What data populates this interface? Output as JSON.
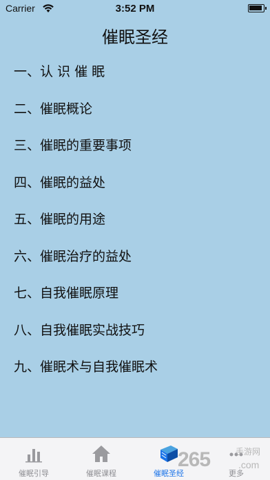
{
  "status_bar": {
    "carrier": "Carrier",
    "time": "3:52 PM"
  },
  "page": {
    "title": "催眠圣经"
  },
  "menu": {
    "items": [
      {
        "label": "一、认 识 催 眠"
      },
      {
        "label": "二、催眠概论"
      },
      {
        "label": "三、催眠的重要事项"
      },
      {
        "label": "四、催眠的益处"
      },
      {
        "label": "五、催眠的用途"
      },
      {
        "label": "六、催眠治疗的益处"
      },
      {
        "label": "七、自我催眠原理"
      },
      {
        "label": "八、自我催眠实战技巧"
      },
      {
        "label": "九、催眠术与自我催眠术"
      }
    ]
  },
  "tab_bar": {
    "tabs": [
      {
        "label": "催眠引导",
        "icon": "bar-chart-icon"
      },
      {
        "label": "催眠课程",
        "icon": "home-icon"
      },
      {
        "label": "催眠圣经",
        "icon": "book-icon"
      },
      {
        "label": "更多",
        "icon": "more-icon"
      }
    ],
    "active_index": 2
  },
  "watermark": {
    "logo": "265",
    "text": "手游网",
    "sub": ".com"
  },
  "colors": {
    "background": "#a9cfe6",
    "tab_bar": "#f4f4f6",
    "active": "#1a73e8",
    "inactive": "#8e8e93"
  }
}
